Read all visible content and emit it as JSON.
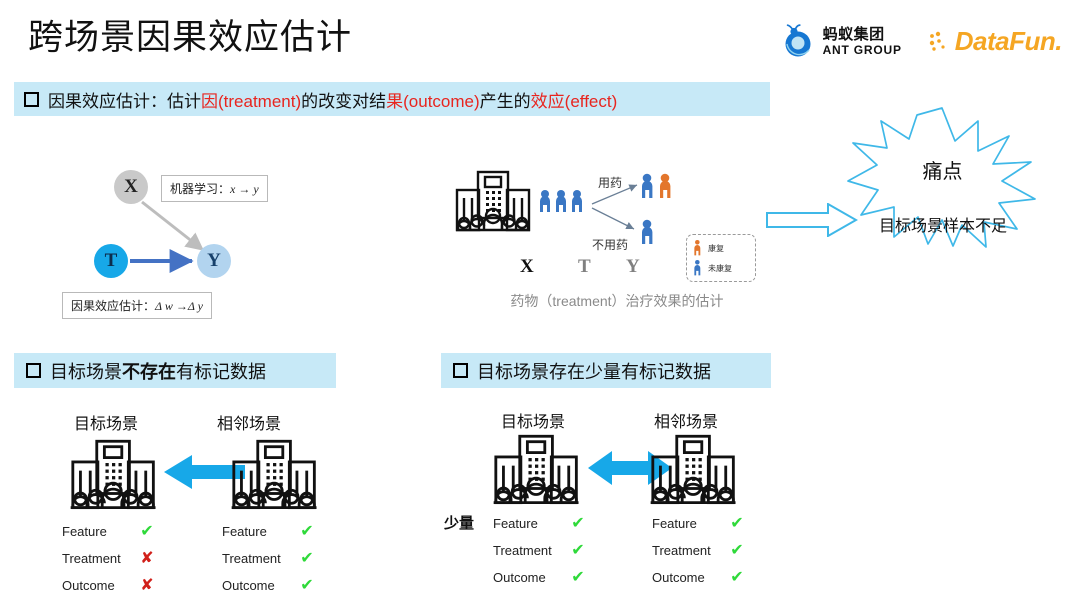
{
  "slide": {
    "title": "跨场景因果效应估计"
  },
  "logos": {
    "ant": {
      "cn": "蚂蚁集团",
      "en": "ANT GROUP",
      "mark": "ant-logo-icon",
      "color": "#1677d2"
    },
    "datafun": {
      "text": "DataFun.",
      "color": "#F5A623"
    }
  },
  "banner_main": {
    "bullet": "square-bullet-icon",
    "segments": [
      {
        "text": "因果效应估计：估计",
        "color": "#111111"
      },
      {
        "text": "因(treatment)",
        "color": "#e8251f"
      },
      {
        "text": "的改变对结",
        "color": "#111111"
      },
      {
        "text": "果(outcome)",
        "color": "#e8251f"
      },
      {
        "text": "产生的",
        "color": "#111111"
      },
      {
        "text": "效应(effect)",
        "color": "#e8251f"
      }
    ],
    "bg": "#c7e9f7"
  },
  "causal_graph": {
    "nodes": [
      {
        "id": "X",
        "label": "X",
        "color": "#c9c9c9"
      },
      {
        "id": "T",
        "label": "T",
        "color": "#17a8e8"
      },
      {
        "id": "Y",
        "label": "Y",
        "color": "#b2d4ef"
      }
    ],
    "edges": [
      {
        "from": "X",
        "to": "Y",
        "color": "#bdbdbd"
      },
      {
        "from": "T",
        "to": "Y",
        "color": "#4472c4"
      }
    ],
    "label_ml": {
      "prefix": "机器学习：",
      "formula": "x → y"
    },
    "label_ce": {
      "prefix": "因果效应估计：",
      "formula": "Δ w →Δ y"
    }
  },
  "treatment_diagram": {
    "branch_top": "用药",
    "branch_bottom": "不用药",
    "axis": {
      "x": "X",
      "t": "T",
      "y": "Y"
    },
    "caption": "药物（treatment）治疗效果的估计",
    "legend": [
      {
        "label": "康复",
        "color": "#e3762c",
        "icon": "person-icon"
      },
      {
        "label": "未康复",
        "color": "#3a77c4",
        "icon": "person-icon"
      }
    ],
    "hospital_icon": "hospital-building-icon",
    "cohort_count": 3
  },
  "pain_point": {
    "star_label": "痛点",
    "subtitle": "目标场景样本不足",
    "star_color": "#3fb8e8",
    "arrow_color": "#3fb8e8",
    "arrow_icon": "right-arrow-outline-icon"
  },
  "panels": [
    {
      "id": "no-labeled-data",
      "banner": {
        "bullet": "square-bullet-icon",
        "segments": [
          {
            "text": "目标场景",
            "bold": false
          },
          {
            "text": "不存在",
            "bold": true
          },
          {
            "text": "有标记数据",
            "bold": false
          }
        ]
      },
      "arrow": {
        "direction": "left",
        "icon": "left-arrow-icon",
        "color": "#17a8e8"
      },
      "quantity_label": "",
      "scenes": [
        {
          "title": "目标场景",
          "icon": "hospital-building-icon",
          "attributes": [
            {
              "name": "Feature",
              "mark": "check",
              "symbol": "✔"
            },
            {
              "name": "Treatment",
              "mark": "cross",
              "symbol": "✘"
            },
            {
              "name": "Outcome",
              "mark": "cross",
              "symbol": "✘"
            }
          ]
        },
        {
          "title": "相邻场景",
          "icon": "hospital-building-icon",
          "attributes": [
            {
              "name": "Feature",
              "mark": "check",
              "symbol": "✔"
            },
            {
              "name": "Treatment",
              "mark": "check",
              "symbol": "✔"
            },
            {
              "name": "Outcome",
              "mark": "check",
              "symbol": "✔"
            }
          ]
        }
      ]
    },
    {
      "id": "few-labeled-data",
      "banner": {
        "bullet": "square-bullet-icon",
        "segments": [
          {
            "text": "目标场景存在少量有标记数据",
            "bold": false
          }
        ]
      },
      "arrow": {
        "direction": "both",
        "icon": "double-arrow-icon",
        "color": "#17a8e8"
      },
      "quantity_label": "少量",
      "scenes": [
        {
          "title": "目标场景",
          "icon": "hospital-building-icon",
          "attributes": [
            {
              "name": "Feature",
              "mark": "check",
              "symbol": "✔"
            },
            {
              "name": "Treatment",
              "mark": "check",
              "symbol": "✔"
            },
            {
              "name": "Outcome",
              "mark": "check",
              "symbol": "✔"
            }
          ]
        },
        {
          "title": "相邻场景",
          "icon": "hospital-building-icon",
          "attributes": [
            {
              "name": "Feature",
              "mark": "check",
              "symbol": "✔"
            },
            {
              "name": "Treatment",
              "mark": "check",
              "symbol": "✔"
            },
            {
              "name": "Outcome",
              "mark": "check",
              "symbol": "✔"
            }
          ]
        }
      ]
    }
  ],
  "colors": {
    "banner_bg": "#c7e9f7",
    "accent_blue": "#17a8e8",
    "red": "#e8251f",
    "green": "#2fd93a",
    "orange": "#e3762c"
  }
}
